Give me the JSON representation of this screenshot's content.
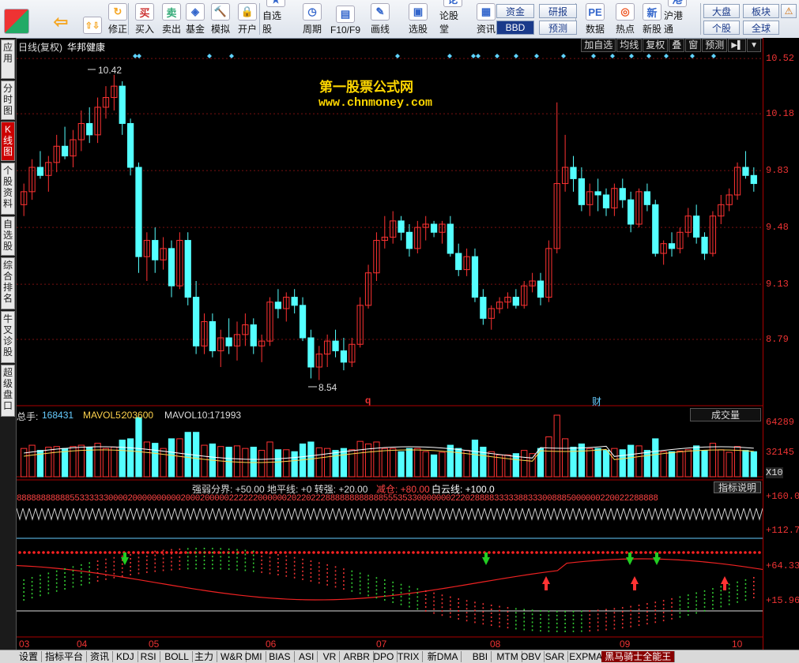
{
  "toolbar": {
    "buttons": [
      {
        "label": "",
        "icon": "app-logo-icon"
      },
      {
        "label": "",
        "icon": "back-arrow-icon"
      },
      {
        "label": "",
        "icon": "up-down-arrow-icon"
      },
      {
        "label": "修正",
        "icon": "refresh-icon"
      },
      {
        "label": "买入",
        "icon": "buy-icon",
        "glyph": "买"
      },
      {
        "label": "卖出",
        "icon": "sell-icon",
        "glyph": "卖"
      },
      {
        "label": "基金",
        "icon": "fund-icon",
        "glyph": "◈"
      },
      {
        "label": "模拟",
        "icon": "hammer-icon",
        "glyph": "🔨"
      },
      {
        "label": "开户",
        "icon": "lock-icon",
        "glyph": "🔒"
      },
      {
        "label": "自选股",
        "icon": "star-folder-icon",
        "glyph": "★"
      },
      {
        "label": "周期",
        "icon": "clock-icon",
        "glyph": "◷"
      },
      {
        "label": "F10/F9",
        "icon": "f10-icon",
        "glyph": "▤"
      },
      {
        "label": "画线",
        "icon": "pencil-icon",
        "glyph": "✎"
      },
      {
        "label": "选股",
        "icon": "screen-icon",
        "glyph": "▣"
      },
      {
        "label": "论股堂",
        "icon": "forum-icon",
        "glyph": "论"
      },
      {
        "label": "资讯",
        "icon": "news-icon",
        "glyph": "▦"
      },
      {
        "label": "数据",
        "icon": "pe-icon",
        "glyph": "PE"
      },
      {
        "label": "热点",
        "icon": "hot-icon",
        "glyph": "◎"
      },
      {
        "label": "新股",
        "icon": "ipo-icon",
        "glyph": "新"
      },
      {
        "label": "沪港通",
        "icon": "sse-hkex-icon",
        "glyph": "港"
      }
    ],
    "small": [
      "资金",
      "BBD",
      "研报",
      "预测",
      "大盘",
      "个股",
      "板块",
      "全球"
    ]
  },
  "sidebar": [
    "应用",
    "分时图",
    "K线图",
    "个股资料",
    "自选股",
    "综合排名",
    "牛叉诊股",
    "超级盘口"
  ],
  "chart_header": {
    "period": "日线(复权)",
    "stock_name": "华邦健康",
    "menu": [
      "加自选",
      "均线",
      "复权",
      "叠",
      "窗",
      "预测"
    ]
  },
  "watermark": {
    "line1": "第一股票公式网",
    "line2": "www.chnmoney.com"
  },
  "price_axis": [
    "10.52",
    "10.18",
    "9.83",
    "9.48",
    "9.13",
    "8.79"
  ],
  "annotations": {
    "high": "10.42",
    "low": "8.54",
    "q_marker": "q",
    "cai_marker": "财"
  },
  "volume_header": {
    "total_label": "总手:",
    "total_value": "168431",
    "ma5_label": "MAVOL5:",
    "ma5_value": "203600",
    "ma10_label": "MAVOL10:",
    "ma10_value": "171993",
    "dropdown": "成交量"
  },
  "volume_axis": [
    "64289",
    "32145",
    "X10"
  ],
  "indicator_header": {
    "text": "强弱分界: +50.00 地平线: +0 转强: +20.00",
    "reduce": "减仓: +80.00",
    "cloud": "白云线: +100.0",
    "help": "指标说明"
  },
  "indicator_axis": [
    "+160.0",
    "+112.7",
    "+64.33",
    "+15.96"
  ],
  "indicator_digits": "8888888888855333333000020000000000200020000022222200000020220222888888888888555353300000002220288883333388333008885000000220022288888",
  "dates": [
    "03",
    "04",
    "05",
    "06",
    "07",
    "08",
    "09",
    "10"
  ],
  "bottom_tabs": [
    "设置",
    "指标平台",
    "资讯",
    "KDJ",
    "RSI",
    "BOLL",
    "主力",
    "W&R",
    "DMI",
    "BIAS",
    "ASI",
    "VR",
    "ARBR",
    "DPO",
    "TRIX",
    "新DMA",
    "BBI",
    "MTM",
    "OBV",
    "SAR",
    "EXPMA",
    "黑马骑士全能王"
  ],
  "colors": {
    "up": "#ff3232",
    "down": "#54ffff",
    "accent_red": "#cc0000",
    "watermark": "#ffd700"
  },
  "chart_data": {
    "type": "candlestick",
    "title": "华邦健康 日线(复权)",
    "ylim": [
      8.45,
      10.55
    ],
    "candles": [
      [
        9.62,
        9.75,
        9.55,
        9.7
      ],
      [
        9.7,
        9.9,
        9.65,
        9.85
      ],
      [
        9.85,
        9.95,
        9.78,
        9.8
      ],
      [
        9.8,
        9.92,
        9.7,
        9.88
      ],
      [
        9.88,
        10.05,
        9.82,
        9.98
      ],
      [
        9.98,
        10.1,
        9.9,
        9.92
      ],
      [
        9.92,
        10.08,
        9.85,
        10.02
      ],
      [
        10.02,
        10.2,
        9.95,
        10.12
      ],
      [
        10.12,
        10.22,
        10.0,
        10.05
      ],
      [
        10.05,
        10.28,
        10.0,
        10.22
      ],
      [
        10.22,
        10.35,
        10.15,
        10.28
      ],
      [
        10.28,
        10.42,
        10.2,
        10.35
      ],
      [
        10.35,
        10.38,
        10.05,
        10.12
      ],
      [
        10.12,
        10.15,
        9.8,
        9.85
      ],
      [
        9.85,
        9.88,
        9.2,
        9.3
      ],
      [
        9.3,
        9.45,
        9.15,
        9.4
      ],
      [
        9.4,
        9.48,
        9.2,
        9.28
      ],
      [
        9.28,
        9.42,
        9.22,
        9.35
      ],
      [
        9.35,
        9.4,
        9.05,
        9.12
      ],
      [
        9.12,
        9.45,
        9.1,
        9.4
      ],
      [
        9.4,
        9.45,
        9.0,
        9.05
      ],
      [
        9.05,
        9.15,
        8.7,
        8.75
      ],
      [
        8.75,
        8.95,
        8.7,
        8.9
      ],
      [
        8.9,
        8.95,
        8.68,
        8.72
      ],
      [
        8.72,
        8.85,
        8.62,
        8.8
      ],
      [
        8.8,
        8.92,
        8.7,
        8.75
      ],
      [
        8.75,
        8.9,
        8.66,
        8.82
      ],
      [
        8.82,
        8.95,
        8.75,
        8.88
      ],
      [
        8.88,
        8.92,
        8.7,
        8.75
      ],
      [
        8.75,
        8.82,
        8.65,
        8.78
      ],
      [
        8.78,
        9.05,
        8.75,
        9.02
      ],
      [
        9.02,
        9.1,
        8.92,
        8.98
      ],
      [
        8.98,
        9.08,
        8.9,
        9.05
      ],
      [
        9.05,
        9.1,
        8.95,
        9.0
      ],
      [
        9.0,
        9.05,
        8.78,
        8.8
      ],
      [
        8.8,
        8.85,
        8.55,
        8.62
      ],
      [
        8.62,
        8.75,
        8.54,
        8.7
      ],
      [
        8.7,
        8.82,
        8.62,
        8.78
      ],
      [
        8.78,
        8.85,
        8.68,
        8.72
      ],
      [
        8.72,
        8.8,
        8.6,
        8.65
      ],
      [
        8.65,
        8.8,
        8.62,
        8.76
      ],
      [
        8.76,
        9.05,
        8.74,
        9.0
      ],
      [
        9.0,
        9.25,
        8.98,
        9.2
      ],
      [
        9.2,
        9.45,
        9.15,
        9.4
      ],
      [
        9.4,
        9.55,
        9.35,
        9.42
      ],
      [
        9.42,
        9.58,
        9.38,
        9.52
      ],
      [
        9.52,
        9.55,
        9.4,
        9.45
      ],
      [
        9.45,
        9.5,
        9.3,
        9.35
      ],
      [
        9.35,
        9.52,
        9.32,
        9.48
      ],
      [
        9.48,
        9.55,
        9.4,
        9.5
      ],
      [
        9.5,
        9.52,
        9.42,
        9.45
      ],
      [
        9.45,
        9.52,
        9.38,
        9.5
      ],
      [
        9.5,
        9.55,
        9.3,
        9.32
      ],
      [
        9.32,
        9.38,
        9.18,
        9.22
      ],
      [
        9.22,
        9.35,
        9.18,
        9.3
      ],
      [
        9.3,
        9.35,
        9.02,
        9.05
      ],
      [
        9.05,
        9.1,
        8.88,
        8.92
      ],
      [
        8.92,
        9.0,
        8.85,
        8.98
      ],
      [
        8.98,
        9.05,
        8.95,
        9.02
      ],
      [
        9.02,
        9.08,
        8.98,
        9.05
      ],
      [
        9.05,
        9.1,
        8.98,
        9.0
      ],
      [
        9.0,
        9.15,
        8.98,
        9.12
      ],
      [
        9.12,
        9.2,
        9.08,
        9.15
      ],
      [
        9.15,
        9.2,
        9.0,
        9.05
      ],
      [
        9.05,
        9.4,
        9.02,
        9.35
      ],
      [
        9.35,
        10.25,
        9.32,
        9.75
      ],
      [
        9.75,
        10.05,
        9.7,
        9.85
      ],
      [
        9.85,
        9.92,
        9.7,
        9.78
      ],
      [
        9.78,
        9.85,
        9.58,
        9.62
      ],
      [
        9.62,
        9.75,
        9.55,
        9.7
      ],
      [
        9.7,
        9.78,
        9.58,
        9.68
      ],
      [
        9.68,
        9.72,
        9.55,
        9.6
      ],
      [
        9.6,
        9.75,
        9.55,
        9.72
      ],
      [
        9.72,
        9.78,
        9.6,
        9.65
      ],
      [
        9.65,
        9.7,
        9.45,
        9.5
      ],
      [
        9.5,
        9.72,
        9.48,
        9.7
      ],
      [
        9.7,
        9.75,
        9.58,
        9.62
      ],
      [
        9.62,
        9.65,
        9.3,
        9.32
      ],
      [
        9.32,
        9.4,
        9.25,
        9.38
      ],
      [
        9.38,
        9.45,
        9.3,
        9.35
      ],
      [
        9.35,
        9.48,
        9.32,
        9.45
      ],
      [
        9.45,
        9.6,
        9.42,
        9.55
      ],
      [
        9.55,
        9.62,
        9.38,
        9.42
      ],
      [
        9.42,
        9.45,
        9.28,
        9.32
      ],
      [
        9.32,
        9.58,
        9.3,
        9.55
      ],
      [
        9.55,
        9.68,
        9.5,
        9.62
      ],
      [
        9.62,
        9.72,
        9.58,
        9.68
      ],
      [
        9.68,
        9.88,
        9.65,
        9.85
      ],
      [
        9.85,
        9.95,
        9.78,
        9.8
      ],
      [
        9.8,
        9.85,
        9.7,
        9.75
      ]
    ]
  }
}
